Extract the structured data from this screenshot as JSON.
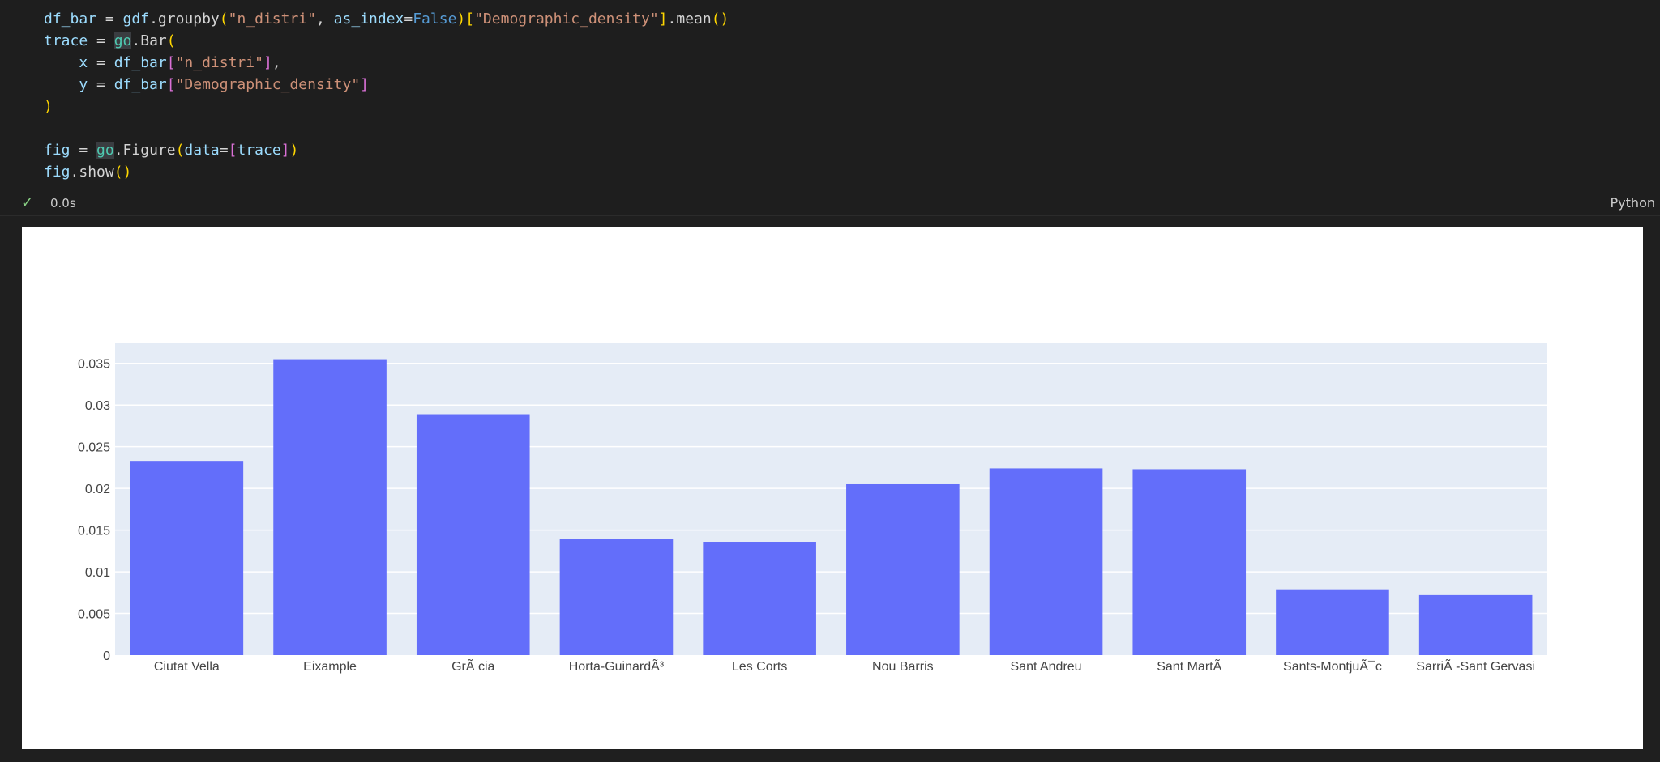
{
  "code": {
    "line1": [
      {
        "t": "df_bar",
        "c": "tk-var"
      },
      {
        "t": " = ",
        "c": "tk-plain"
      },
      {
        "t": "gdf",
        "c": "tk-var"
      },
      {
        "t": ".groupby",
        "c": "tk-plain"
      },
      {
        "t": "(",
        "c": "tk-p1"
      },
      {
        "t": "\"n_distri\"",
        "c": "tk-str"
      },
      {
        "t": ", ",
        "c": "tk-plain"
      },
      {
        "t": "as_index",
        "c": "tk-var"
      },
      {
        "t": "=",
        "c": "tk-plain"
      },
      {
        "t": "False",
        "c": "tk-kw"
      },
      {
        "t": ")",
        "c": "tk-p1"
      },
      {
        "t": "[",
        "c": "tk-p1"
      },
      {
        "t": "\"Demographic_density\"",
        "c": "tk-str"
      },
      {
        "t": "]",
        "c": "tk-p1"
      },
      {
        "t": ".mean",
        "c": "tk-plain"
      },
      {
        "t": "()",
        "c": "tk-p1"
      }
    ],
    "line2": [
      {
        "t": "trace",
        "c": "tk-var"
      },
      {
        "t": " = ",
        "c": "tk-plain"
      },
      {
        "t": "go",
        "c": "tk-hl"
      },
      {
        "t": ".Bar",
        "c": "tk-plain"
      },
      {
        "t": "(",
        "c": "tk-p1"
      }
    ],
    "line3": [
      {
        "t": "    x",
        "c": "tk-var"
      },
      {
        "t": " = ",
        "c": "tk-plain"
      },
      {
        "t": "df_bar",
        "c": "tk-var"
      },
      {
        "t": "[",
        "c": "tk-p2"
      },
      {
        "t": "\"n_distri\"",
        "c": "tk-str"
      },
      {
        "t": "]",
        "c": "tk-p2"
      },
      {
        "t": ",",
        "c": "tk-plain"
      }
    ],
    "line4": [
      {
        "t": "    y",
        "c": "tk-var"
      },
      {
        "t": " = ",
        "c": "tk-plain"
      },
      {
        "t": "df_bar",
        "c": "tk-var"
      },
      {
        "t": "[",
        "c": "tk-p2"
      },
      {
        "t": "\"Demographic_density\"",
        "c": "tk-str"
      },
      {
        "t": "]",
        "c": "tk-p2"
      }
    ],
    "line5": [
      {
        "t": ")",
        "c": "tk-p1"
      }
    ],
    "line7": [
      {
        "t": "fig",
        "c": "tk-var"
      },
      {
        "t": " = ",
        "c": "tk-plain"
      },
      {
        "t": "go",
        "c": "tk-hl"
      },
      {
        "t": ".Figure",
        "c": "tk-plain"
      },
      {
        "t": "(",
        "c": "tk-p1"
      },
      {
        "t": "data",
        "c": "tk-var"
      },
      {
        "t": "=",
        "c": "tk-plain"
      },
      {
        "t": "[",
        "c": "tk-p2"
      },
      {
        "t": "trace",
        "c": "tk-var"
      },
      {
        "t": "]",
        "c": "tk-p2"
      },
      {
        "t": ")",
        "c": "tk-p1"
      }
    ],
    "line8": [
      {
        "t": "fig",
        "c": "tk-var"
      },
      {
        "t": ".show",
        "c": "tk-plain"
      },
      {
        "t": "()",
        "c": "tk-p1"
      }
    ]
  },
  "status": {
    "check": "✓",
    "duration": "0.0s",
    "language": "Python"
  },
  "colors": {
    "bar": "#636efa",
    "plot_bg": "#e5ecf6",
    "grid": "#ffffff"
  },
  "chart_data": {
    "type": "bar",
    "categories": [
      "Ciutat Vella",
      "Eixample",
      "GrÃ cia",
      "Horta-GuinardÃ³",
      "Les Corts",
      "Nou Barris",
      "Sant Andreu",
      "Sant MartÃ",
      "Sants-MontjuÃ¯c",
      "SarriÃ -Sant Gervasi"
    ],
    "values": [
      0.0233,
      0.0355,
      0.0289,
      0.0139,
      0.0136,
      0.0205,
      0.0224,
      0.0223,
      0.0079,
      0.0072
    ],
    "ylim": [
      0,
      0.0375
    ],
    "yticks": [
      0,
      0.005,
      0.01,
      0.015,
      0.02,
      0.025,
      0.03,
      0.035
    ],
    "ytick_labels": [
      "0",
      "0.005",
      "0.01",
      "0.015",
      "0.02",
      "0.025",
      "0.03",
      "0.035"
    ],
    "grid": true
  }
}
